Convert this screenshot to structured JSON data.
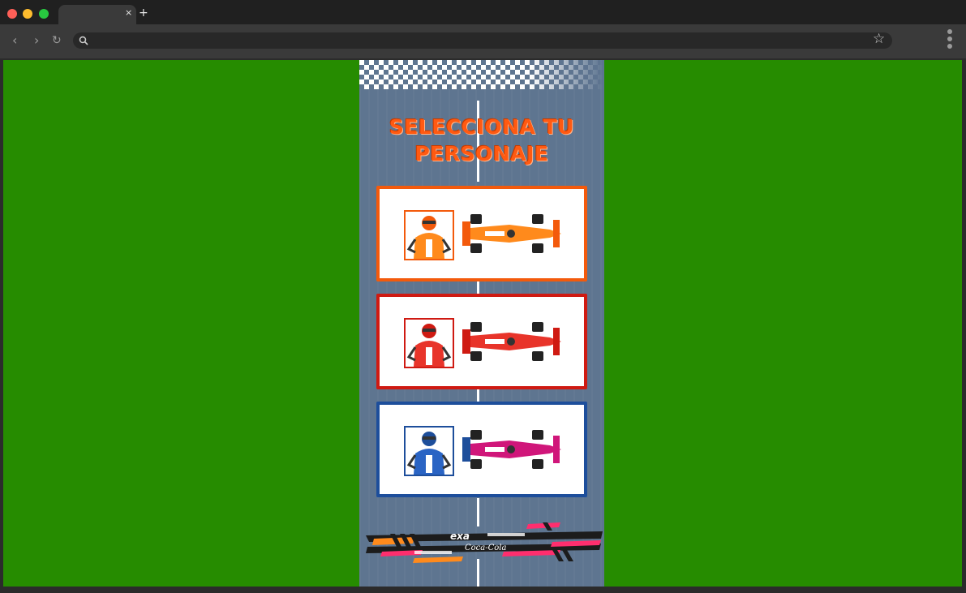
{
  "browser": {
    "tab_close": "×",
    "new_tab": "+",
    "back_icon": "‹",
    "forward_icon": "›",
    "reload_icon": "↻",
    "address_value": "",
    "star_icon": "☆"
  },
  "game": {
    "title_line1": "SELECCIONA TU",
    "title_line2": "PERSONAJE",
    "characters": [
      {
        "id": "orange",
        "color": "#f35a0c",
        "accent": "#ff8a1c"
      },
      {
        "id": "red",
        "color": "#cf1a12",
        "accent": "#e8342a"
      },
      {
        "id": "blue",
        "color": "#1d4e9b",
        "accent": "#d0167a"
      }
    ],
    "footer": {
      "brand1": "exa",
      "brand2": "Coca-Cola"
    }
  },
  "colors": {
    "page_bg": "#268c00",
    "track": "#5e7590",
    "title": "#ff5a12"
  }
}
